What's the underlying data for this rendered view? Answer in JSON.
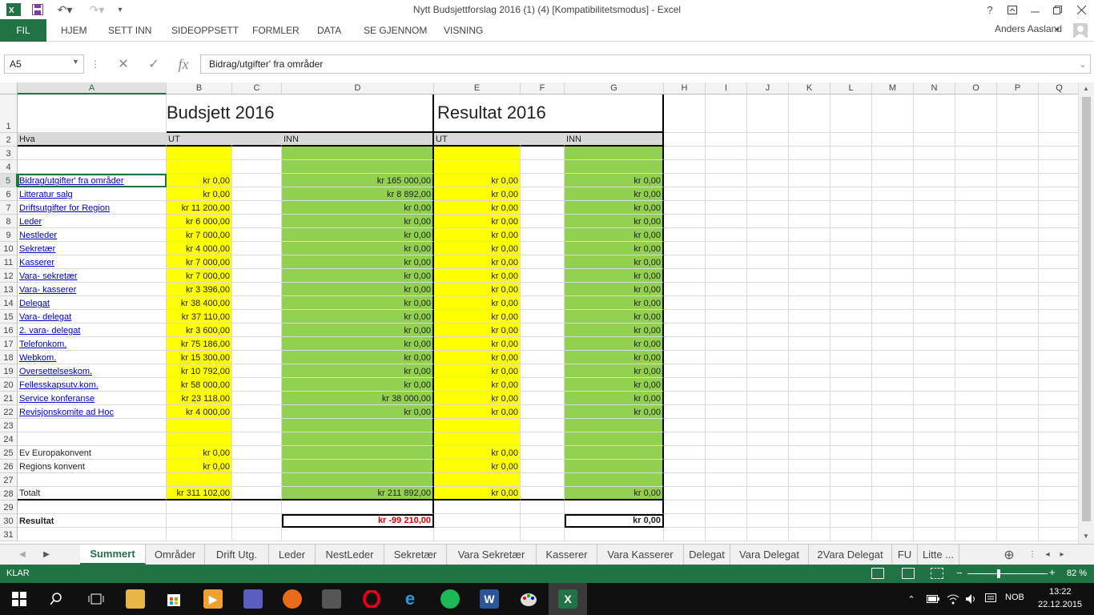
{
  "window": {
    "title": "Nytt Budsjettforslag 2016 (1) (4)  [Kompatibilitetsmodus] - Excel",
    "help": "?",
    "user": "Anders Aasland"
  },
  "ribbon": {
    "file_tab": "FIL",
    "tabs": [
      "HJEM",
      "SETT INN",
      "SIDEOPPSETT",
      "FORMLER",
      "DATA",
      "SE GJENNOM",
      "VISNING"
    ]
  },
  "formula_bar": {
    "name_box": "A5",
    "fx": "fx",
    "formula": "Bidrag/utgifter' fra områder"
  },
  "grid": {
    "columns": [
      "A",
      "B",
      "C",
      "D",
      "E",
      "F",
      "G",
      "H",
      "I",
      "J",
      "K",
      "L",
      "M",
      "N",
      "O",
      "P",
      "Q"
    ],
    "rows": [
      "1",
      "2",
      "3",
      "4",
      "5",
      "6",
      "7",
      "8",
      "9",
      "10",
      "11",
      "12",
      "13",
      "14",
      "15",
      "16",
      "17",
      "18",
      "19",
      "20",
      "21",
      "22",
      "23",
      "24",
      "25",
      "26",
      "27",
      "28",
      "29",
      "30",
      "31"
    ],
    "title_budget": "Budsjett 2016",
    "title_result": "Resultat 2016",
    "header": {
      "a": "Hva",
      "b": "UT",
      "d": "INN",
      "e": "UT",
      "g": "INN"
    },
    "lines": [
      {
        "a": "Bidrag/utgifter' fra områder",
        "b": "kr 0,00",
        "d": "kr 165 000,00",
        "e": "kr 0,00",
        "g": "kr 0,00",
        "link": true
      },
      {
        "a": "Litteratur salg",
        "b": "kr 0,00",
        "d": "kr 8 892,00",
        "e": "kr 0,00",
        "g": "kr 0,00",
        "link": true
      },
      {
        "a": "Driftsutgifter for Region",
        "b": "kr 11 200,00",
        "d": "kr 0,00",
        "e": "kr 0,00",
        "g": "kr 0,00",
        "link": true
      },
      {
        "a": "Leder",
        "b": "kr 6 000,00",
        "d": "kr 0,00",
        "e": "kr 0,00",
        "g": "kr 0,00",
        "link": true
      },
      {
        "a": "Nestleder",
        "b": "kr 7 000,00",
        "d": "kr 0,00",
        "e": "kr 0,00",
        "g": "kr 0,00",
        "link": true
      },
      {
        "a": "Sekretær",
        "b": "kr 4 000,00",
        "d": "kr 0,00",
        "e": "kr 0,00",
        "g": "kr 0,00",
        "link": true
      },
      {
        "a": "Kasserer",
        "b": "kr 7 000,00",
        "d": "kr 0,00",
        "e": "kr 0,00",
        "g": "kr 0,00",
        "link": true
      },
      {
        "a": "Vara- sekretær",
        "b": "kr 7 000,00",
        "d": "kr 0,00",
        "e": "kr 0,00",
        "g": "kr 0,00",
        "link": true
      },
      {
        "a": "Vara- kasserer",
        "b": "kr 3 396,00",
        "d": "kr 0,00",
        "e": "kr 0,00",
        "g": "kr 0,00",
        "link": true
      },
      {
        "a": "Delegat",
        "b": "kr 38 400,00",
        "d": "kr 0,00",
        "e": "kr 0,00",
        "g": "kr 0,00",
        "link": true
      },
      {
        "a": "Vara- delegat",
        "b": "kr 37 110,00",
        "d": "kr 0,00",
        "e": "kr 0,00",
        "g": "kr 0,00",
        "link": true
      },
      {
        "a": "2. vara- delegat",
        "b": "kr 3 600,00",
        "d": "kr 0,00",
        "e": "kr 0,00",
        "g": "kr 0,00",
        "link": true
      },
      {
        "a": "Telefonkom.",
        "b": "kr 75 186,00",
        "d": "kr 0,00",
        "e": "kr 0,00",
        "g": "kr 0,00",
        "link": true
      },
      {
        "a": "Webkom.",
        "b": "kr 15 300,00",
        "d": "kr 0,00",
        "e": "kr 0,00",
        "g": "kr 0,00",
        "link": true
      },
      {
        "a": "Oversettelseskom.",
        "b": "kr 10 792,00",
        "d": "kr 0,00",
        "e": "kr 0,00",
        "g": "kr 0,00",
        "link": true
      },
      {
        "a": "Fellesskapsutv.kom.",
        "b": "kr 58 000,00",
        "d": "kr 0,00",
        "e": "kr 0,00",
        "g": "kr 0,00",
        "link": true
      },
      {
        "a": "Service konferanse",
        "b": "kr 23 118,00",
        "d": "kr 38 000,00",
        "e": "kr 0,00",
        "g": "kr 0,00",
        "link": true
      },
      {
        "a": "Revisjonskomite ad Hoc",
        "b": "kr 4 000,00",
        "d": "kr 0,00",
        "e": "kr 0,00",
        "g": "kr 0,00",
        "link": true
      },
      {
        "a": "",
        "b": "",
        "d": "",
        "e": "",
        "g": "",
        "link": false
      },
      {
        "a": "",
        "b": "",
        "d": "",
        "e": "",
        "g": "",
        "link": false
      },
      {
        "a": "Ev Europakonvent",
        "b": "kr 0,00",
        "d": "",
        "e": "kr 0,00",
        "g": "",
        "link": false
      },
      {
        "a": "Regions konvent",
        "b": "kr 0,00",
        "d": "",
        "e": "kr 0,00",
        "g": "",
        "link": false
      },
      {
        "a": "",
        "b": "",
        "d": "",
        "e": "",
        "g": "",
        "link": false
      },
      {
        "a": "Totalt",
        "b": "kr 311 102,00",
        "d": "kr 211 892,00",
        "e": "kr 0,00",
        "g": "kr 0,00",
        "link": false
      }
    ],
    "result": {
      "label": "Resultat",
      "budget": "kr -99 210,00",
      "actual": "kr 0,00"
    }
  },
  "sheets": {
    "tabs": [
      "Summert",
      "Områder",
      "Drift Utg.",
      "Leder",
      "NestLeder",
      "Sekretær",
      "Vara Sekretær",
      "Kasserer",
      "Vara Kasserer",
      "Delegat",
      "Vara Delegat",
      "2Vara Delegat",
      "FU",
      "Litte ..."
    ],
    "active": "Summert"
  },
  "status": {
    "text": "KLAR",
    "zoom": "82 %"
  },
  "taskbar": {
    "time": "13:22",
    "date": "22.12.2015",
    "lang": "NOB"
  },
  "colors": {
    "excel_green": "#217346",
    "yellow": "#ffff00",
    "green": "#92d050",
    "header_gray": "#d9d9d9",
    "negative_red": "#e00000"
  }
}
